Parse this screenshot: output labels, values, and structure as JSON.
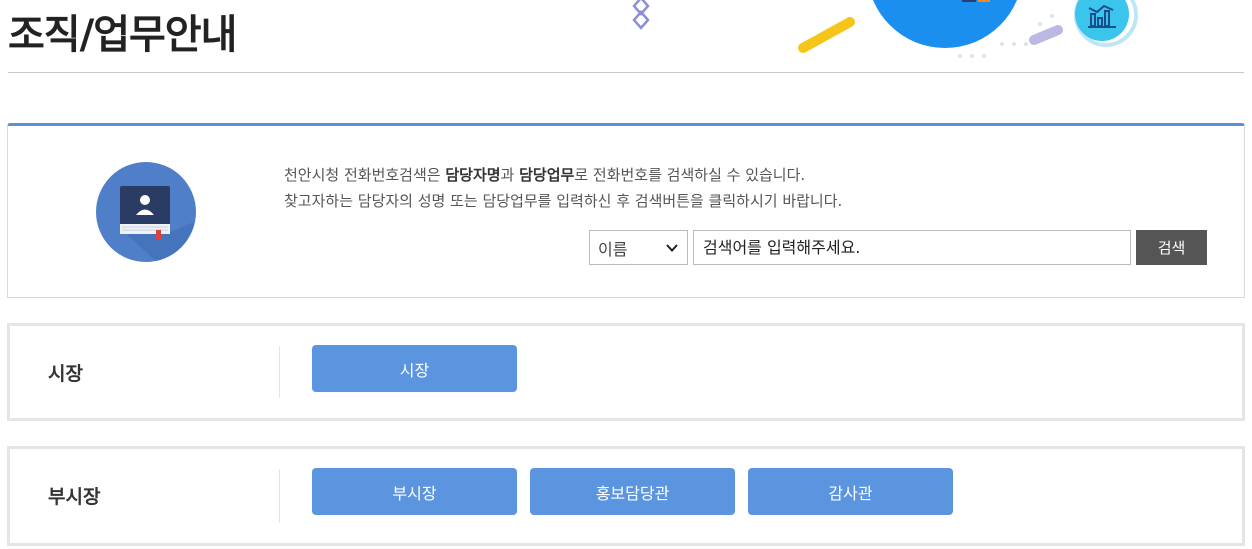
{
  "header": {
    "title": "조직/업무안내"
  },
  "search": {
    "desc_line1_pre": "천안시청 전화번호검색은 ",
    "desc_bold1": "담당자명",
    "desc_mid": "과 ",
    "desc_bold2": "담당업무",
    "desc_line1_post": "로 전화번호를 검색하실 수 있습니다.",
    "desc_line2": "찾고자하는 담당자의 성명 또는 담당업무를 입력하신 후 검색버튼을 클릭하시기 바랍니다.",
    "select_value": "이름",
    "placeholder": "검색어를 입력해주세요.",
    "button_label": "검색"
  },
  "sections": [
    {
      "label": "시장",
      "buttons": [
        "시장"
      ]
    },
    {
      "label": "부시장",
      "buttons": [
        "부시장",
        "홍보담당관",
        "감사관"
      ]
    }
  ],
  "colors": {
    "accent": "#5b8fd6",
    "dept_button": "#5b95e0",
    "search_button": "#555555"
  },
  "icons": {
    "search_panel": "address-book-icon",
    "select": "chevron-down-icon"
  }
}
